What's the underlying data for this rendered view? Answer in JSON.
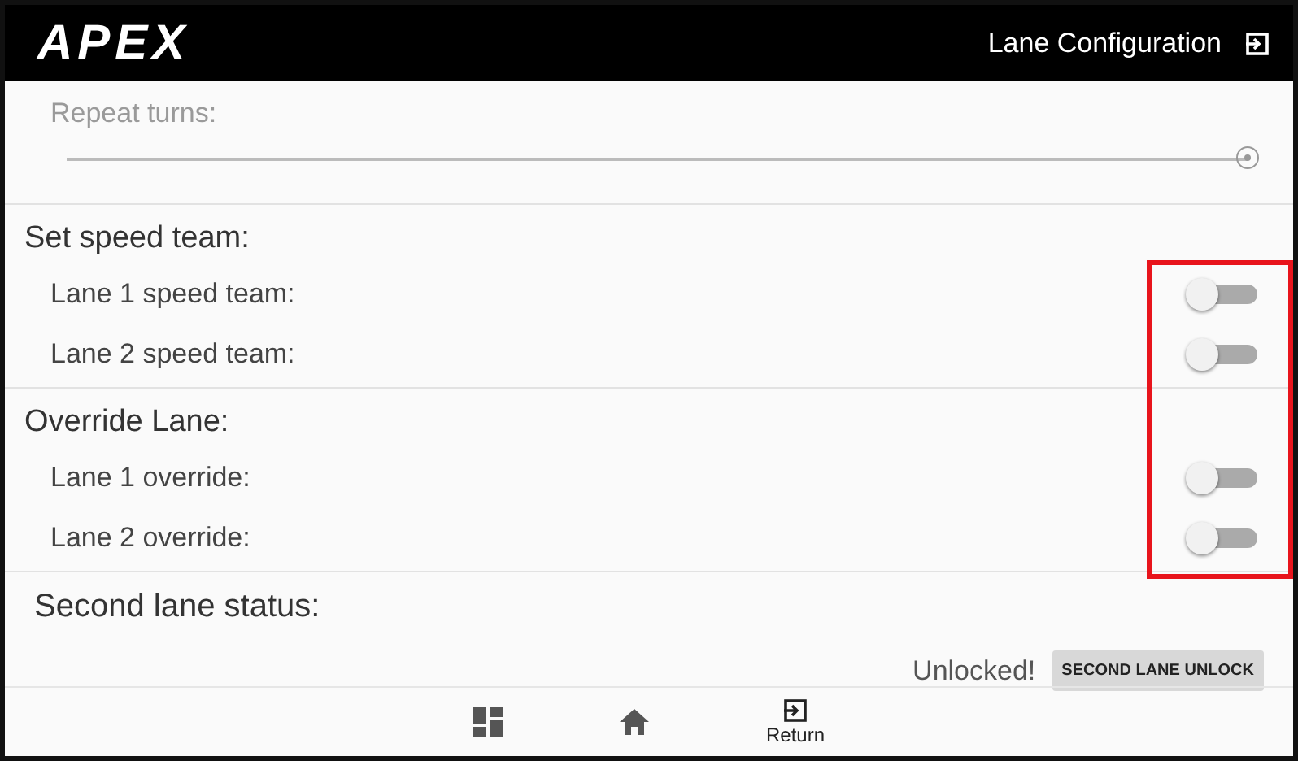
{
  "header": {
    "logo": "APEX",
    "title": "Lane Configuration"
  },
  "repeat_turns": {
    "label": "Repeat turns:",
    "level": 1
  },
  "sections": [
    {
      "title": "Set speed team:",
      "toggles": [
        {
          "label": "Lane 1 speed team:",
          "on": false
        },
        {
          "label": "Lane 2 speed team:",
          "on": false
        }
      ]
    },
    {
      "title": "Override Lane:",
      "toggles": [
        {
          "label": "Lane 1 override:",
          "on": false
        },
        {
          "label": "Lane 2 override:",
          "on": false
        }
      ]
    }
  ],
  "second_lane": {
    "title": "Second lane status:",
    "status": "Unlocked!",
    "button": "SECOND LANE UNLOCK"
  },
  "nav": [
    {
      "kind": "dashboard"
    },
    {
      "kind": "home"
    },
    {
      "kind": "return",
      "label": "Return"
    }
  ]
}
